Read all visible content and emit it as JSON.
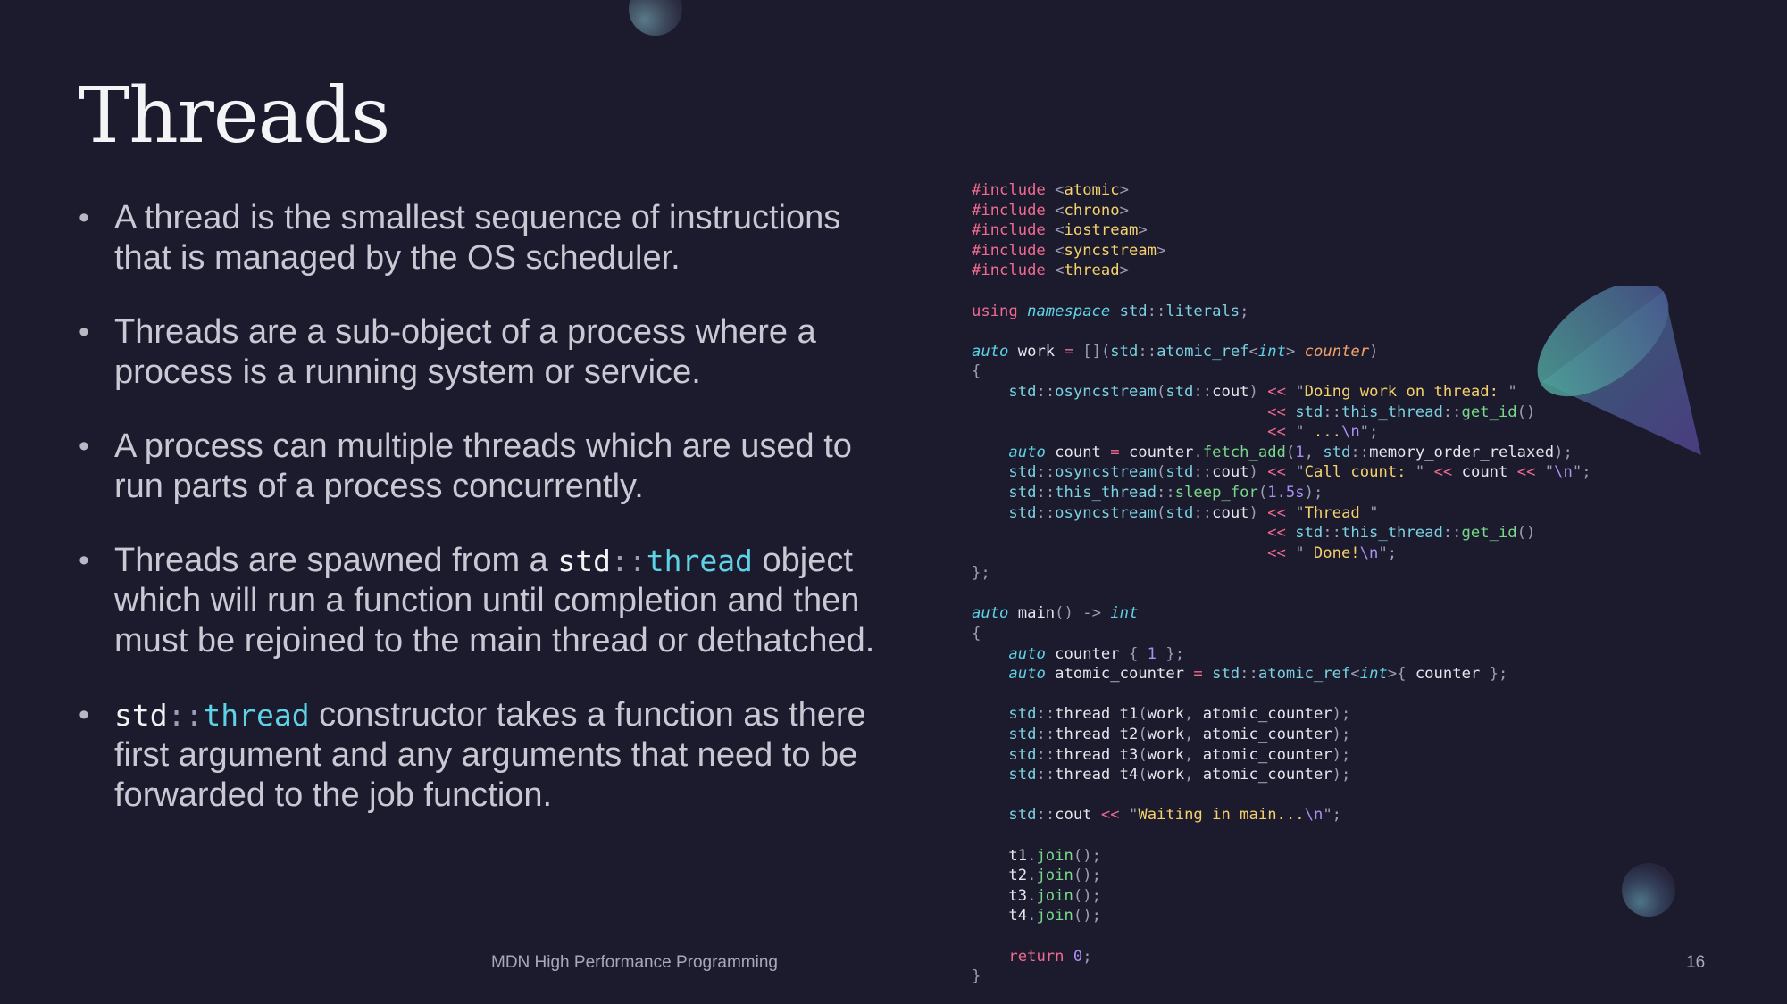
{
  "slide": {
    "title": "Threads",
    "footer": "MDN High Performance Programming",
    "page_number": "16"
  },
  "bullets": [
    {
      "text": "A thread is the smallest sequence of instructions that is managed by the OS scheduler."
    },
    {
      "text": "Threads are a sub-object of a process where a process is a running system or service."
    },
    {
      "text": "A process can multiple threads which are used to run parts of a process concurrently."
    },
    {
      "before": "Threads are spawned from a ",
      "code_ns": "std",
      "code_sep": "::",
      "code_kw": "thread",
      "after": " object which will run a function until completion and then must be rejoined to the main thread or dethatched."
    },
    {
      "before": " ",
      "code_ns": "std",
      "code_sep": "::",
      "code_kw": "thread",
      "after": " constructor takes a function as there first argument and any arguments that need to be forwarded to the job function."
    }
  ],
  "code": {
    "language": "cpp",
    "lines": [
      "#include <atomic>",
      "#include <chrono>",
      "#include <iostream>",
      "#include <syncstream>",
      "#include <thread>",
      "",
      "using namespace std::literals;",
      "",
      "auto work = [](std::atomic_ref<int> counter)",
      "{",
      "    std::osyncstream(std::cout) << \"Doing work on thread: \"",
      "                                << std::this_thread::get_id()",
      "                                << \" ...\\n\";",
      "    auto count = counter.fetch_add(1, std::memory_order_relaxed);",
      "    std::osyncstream(std::cout) << \"Call count: \" << count << \"\\n\";",
      "    std::this_thread::sleep_for(1.5s);",
      "    std::osyncstream(std::cout) << \"Thread \"",
      "                                << std::this_thread::get_id()",
      "                                << \" Done!\\n\";",
      "};",
      "",
      "auto main() -> int",
      "{",
      "    auto counter { 1 };",
      "    auto atomic_counter = std::atomic_ref<int>{ counter };",
      "",
      "    std::thread t1(work, atomic_counter);",
      "    std::thread t2(work, atomic_counter);",
      "    std::thread t3(work, atomic_counter);",
      "    std::thread t4(work, atomic_counter);",
      "",
      "    std::cout << \"Waiting in main...\\n\";",
      "",
      "    t1.join();",
      "    t2.join();",
      "    t3.join();",
      "    t4.join();",
      "",
      "    return 0;",
      "}"
    ]
  },
  "colors": {
    "background": "#1c1b2e",
    "text": "#c9c8d3",
    "preprocessor": "#f06a8f",
    "string": "#f5d16b",
    "type": "#5fd3e6",
    "function": "#79d98a",
    "number": "#ab8ff2"
  },
  "decorations": [
    "sphere-top",
    "cone-right",
    "sphere-bottom-right"
  ]
}
